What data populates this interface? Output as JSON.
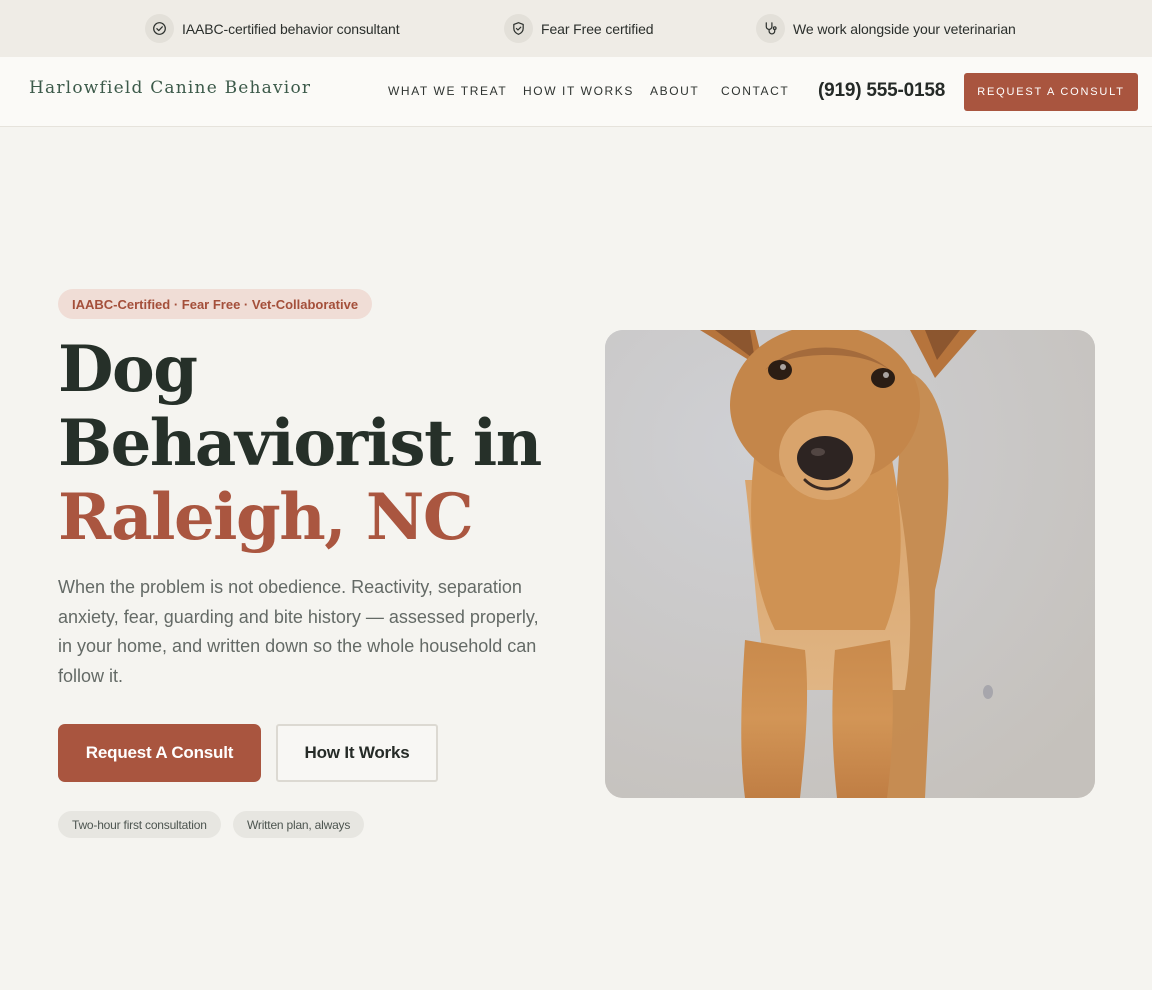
{
  "trustbar": {
    "items": [
      {
        "icon": "check-circle-icon",
        "label": "IAABC-certified behavior consultant"
      },
      {
        "icon": "shield-check-icon",
        "label": "Fear Free certified"
      },
      {
        "icon": "stethoscope-icon",
        "label": "We work alongside your veterinarian"
      }
    ]
  },
  "header": {
    "brand": "Harlowfield Canine Behavior",
    "nav": [
      "WHAT WE TREAT",
      "HOW IT WORKS",
      "ABOUT",
      "CONTACT"
    ],
    "phone": "(919) 555-0158",
    "cta": "REQUEST A CONSULT"
  },
  "hero": {
    "eyebrow": "IAABC-Certified · Fear Free · Vet-Collaborative",
    "title_line1": "Dog",
    "title_line2": "Behaviorist in",
    "title_accent": "Raleigh, NC",
    "lede": "When the problem is not obedience. Reactivity, separation anxiety, fear, guarding and bite history — assessed properly, in your home, and written down so the whole household can follow it.",
    "primary_button": "Request A Consult",
    "secondary_button": "How It Works",
    "chips": [
      "Two-hour first consultation",
      "Written plan, always"
    ]
  },
  "colors": {
    "accent": "#a9553f",
    "brand_green": "#3c5a4a",
    "background": "#f5f4f0"
  }
}
